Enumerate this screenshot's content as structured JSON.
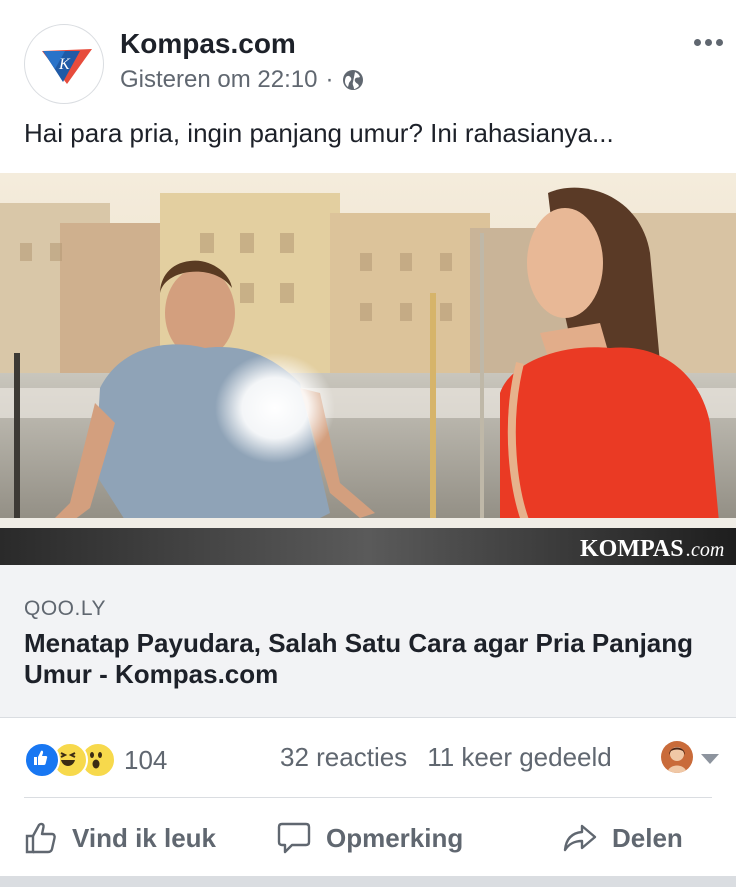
{
  "post": {
    "page_name": "Kompas.com",
    "timestamp": "Gisteren om 22:10",
    "separator": "·",
    "message": "Hai para pria, ingin panjang umur? Ini rahasianya..."
  },
  "photo": {
    "watermark_main": "KOMPAS",
    "watermark_suffix": ".com"
  },
  "link": {
    "domain": "QOO.LY",
    "title": "Menatap Payudara, Salah Satu Cara agar Pria Panjang Umur - Kompas.com"
  },
  "engagement": {
    "reaction_count": "104",
    "comments": "32 reacties",
    "shares": "11 keer gedeeld"
  },
  "actions": {
    "like_label": "Vind ik leuk",
    "comment_label": "Opmerking",
    "share_label": "Delen"
  },
  "colors": {
    "like_blue": "#1877f2",
    "haha_yellow": "#f7d94c",
    "text_dark": "#1d2129",
    "text_gray": "#606770"
  }
}
